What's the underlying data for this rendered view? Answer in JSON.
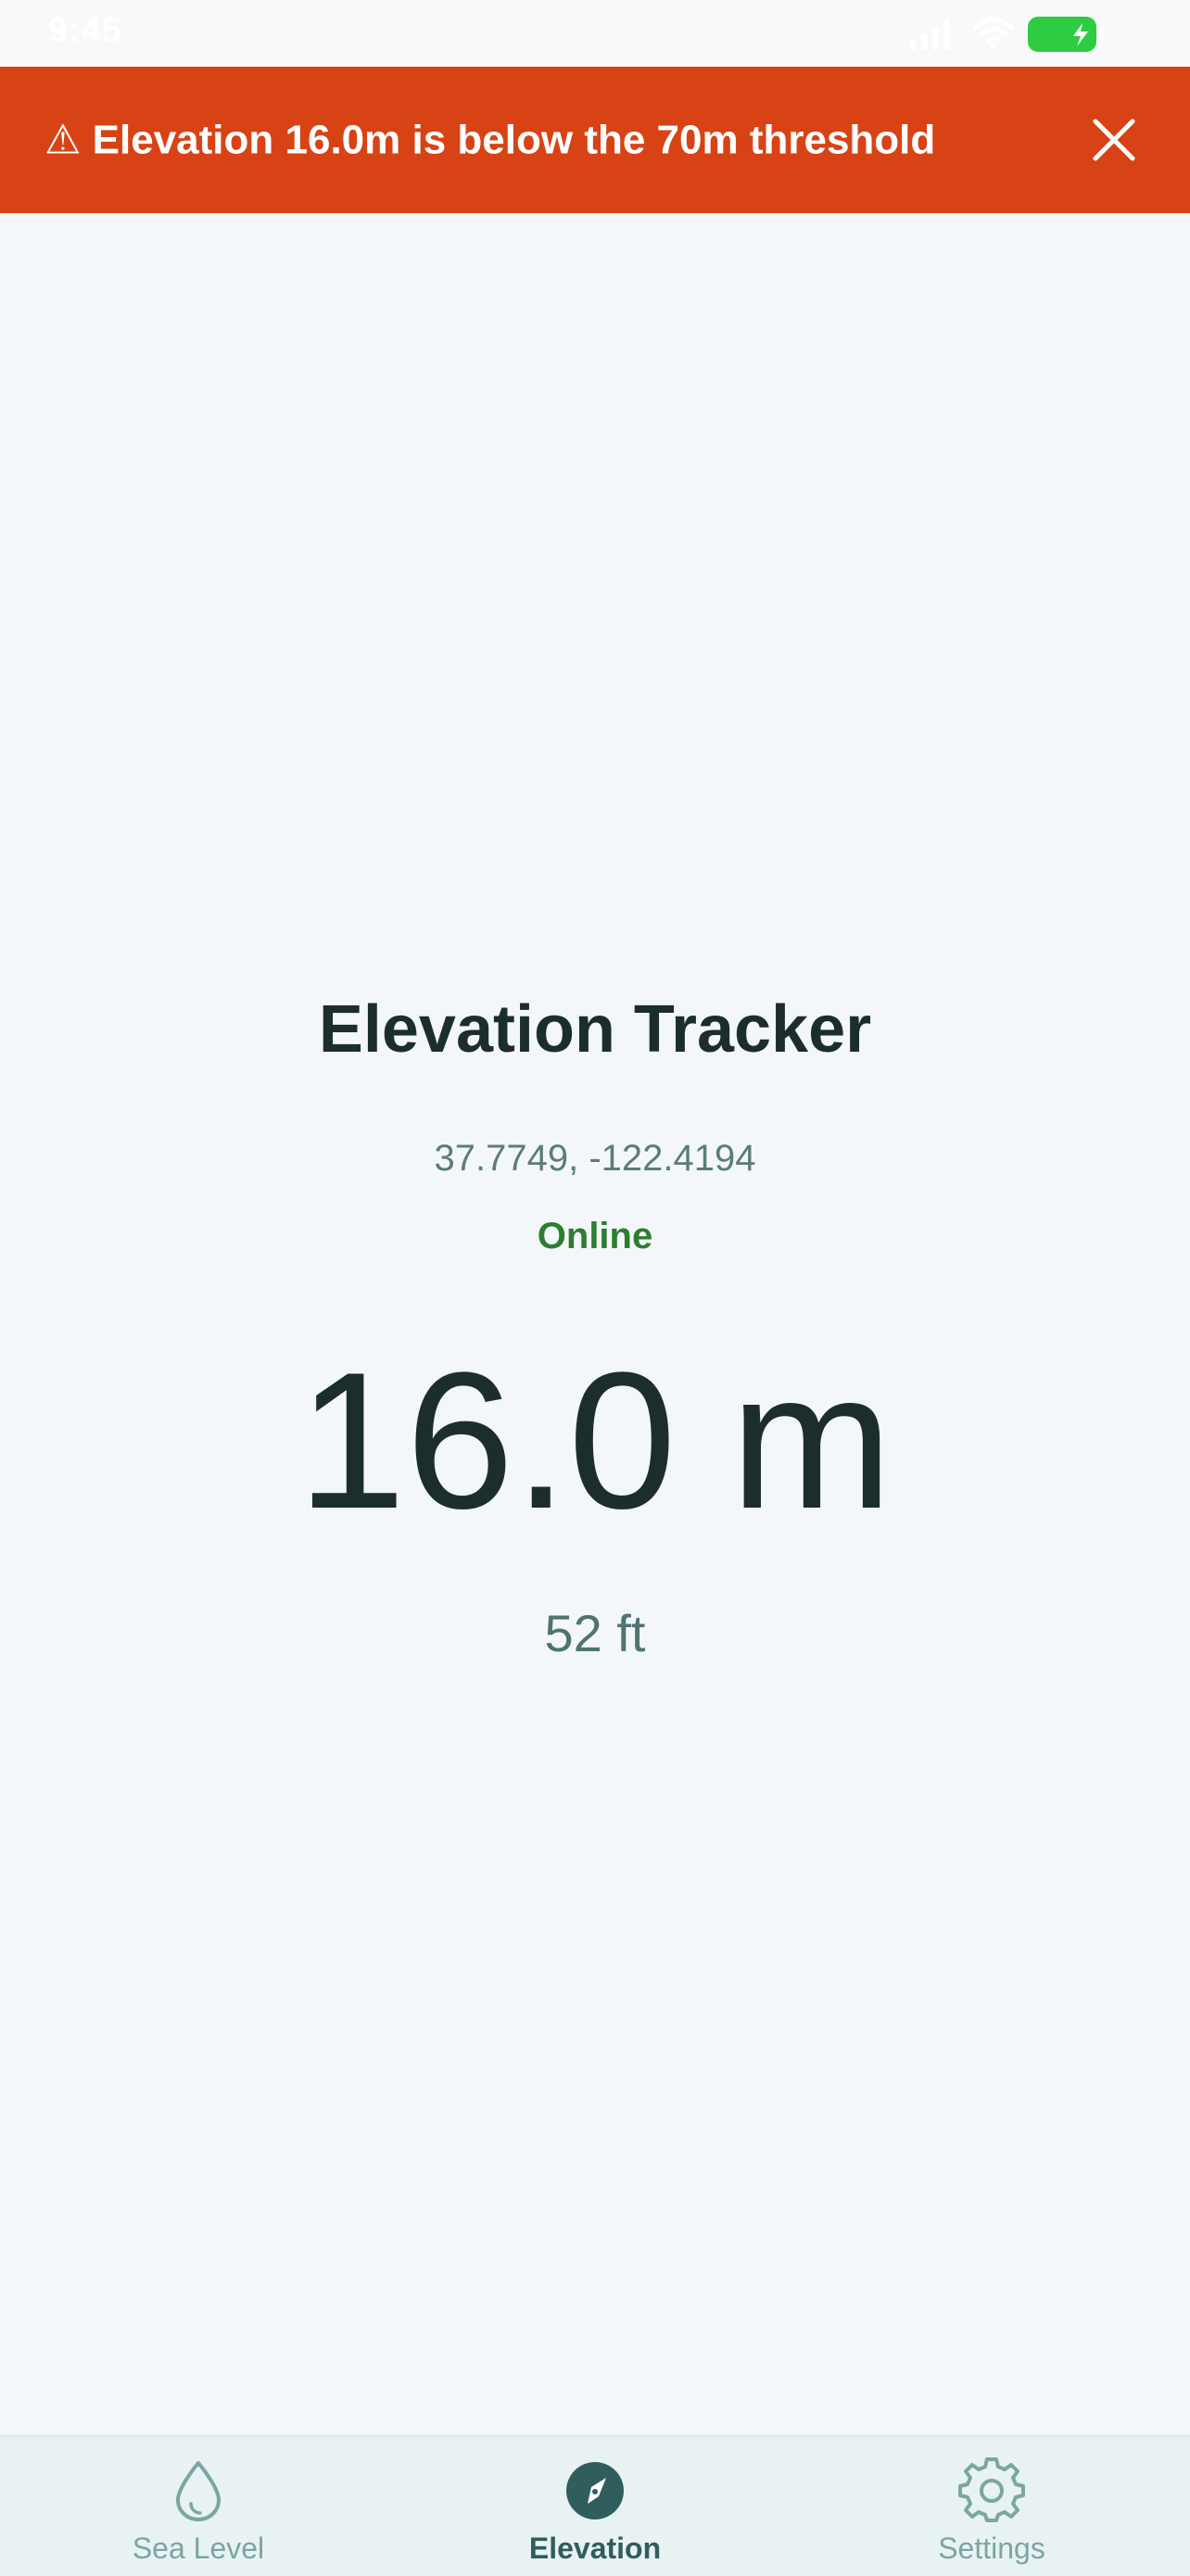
{
  "status_bar": {
    "time": "9:45"
  },
  "alert": {
    "message": "⚠ Elevation 16.0m is below the 70m threshold"
  },
  "main": {
    "title": "Elevation Tracker",
    "coordinates": "37.7749, -122.4194",
    "connection_status": "Online",
    "elevation_m": "16.0 m",
    "elevation_ft": "52 ft"
  },
  "tabs": [
    {
      "label": "Sea Level",
      "icon": "water-drop-icon",
      "active": false
    },
    {
      "label": "Elevation",
      "icon": "compass-icon",
      "active": true
    },
    {
      "label": "Settings",
      "icon": "gear-icon",
      "active": false
    }
  ],
  "colors": {
    "alert_background": "#d84315",
    "online": "#2e7d32",
    "tab_active": "#2f5e5c",
    "tab_inactive": "#7aa6a4",
    "battery": "#2ecc40"
  }
}
